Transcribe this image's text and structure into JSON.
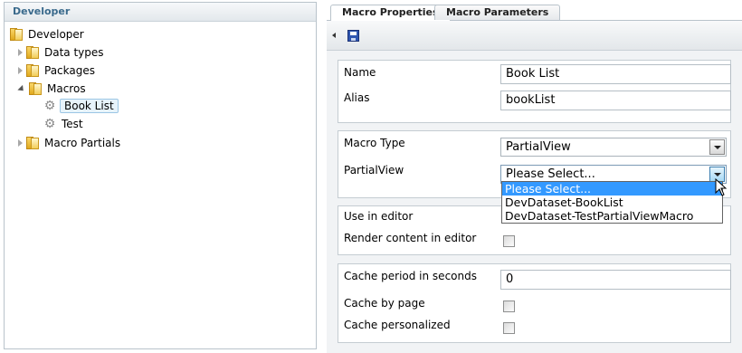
{
  "tree": {
    "header": "Developer",
    "root": "Developer",
    "nodes": {
      "data_types": "Data types",
      "packages": "Packages",
      "macros": "Macros",
      "book_list": "Book List",
      "test": "Test",
      "macro_partials": "Macro Partials"
    }
  },
  "tabs": {
    "properties": "Macro Properties",
    "parameters": "Macro Parameters"
  },
  "form": {
    "name_label": "Name",
    "name_value": "Book List",
    "alias_label": "Alias",
    "alias_value": "bookList",
    "macro_type_label": "Macro Type",
    "macro_type_value": "PartialView",
    "partial_view_label": "PartialView",
    "partial_view_value": "Please Select...",
    "use_in_editor_label": "Use in editor",
    "render_content_label": "Render content in editor",
    "cache_period_label": "Cache period in seconds",
    "cache_period_value": "0",
    "cache_by_page_label": "Cache by page",
    "cache_personalized_label": "Cache personalized"
  },
  "dropdown": {
    "options": [
      "Please Select...",
      "DevDataset-BookList",
      "DevDataset-TestPartialViewMacro"
    ]
  }
}
